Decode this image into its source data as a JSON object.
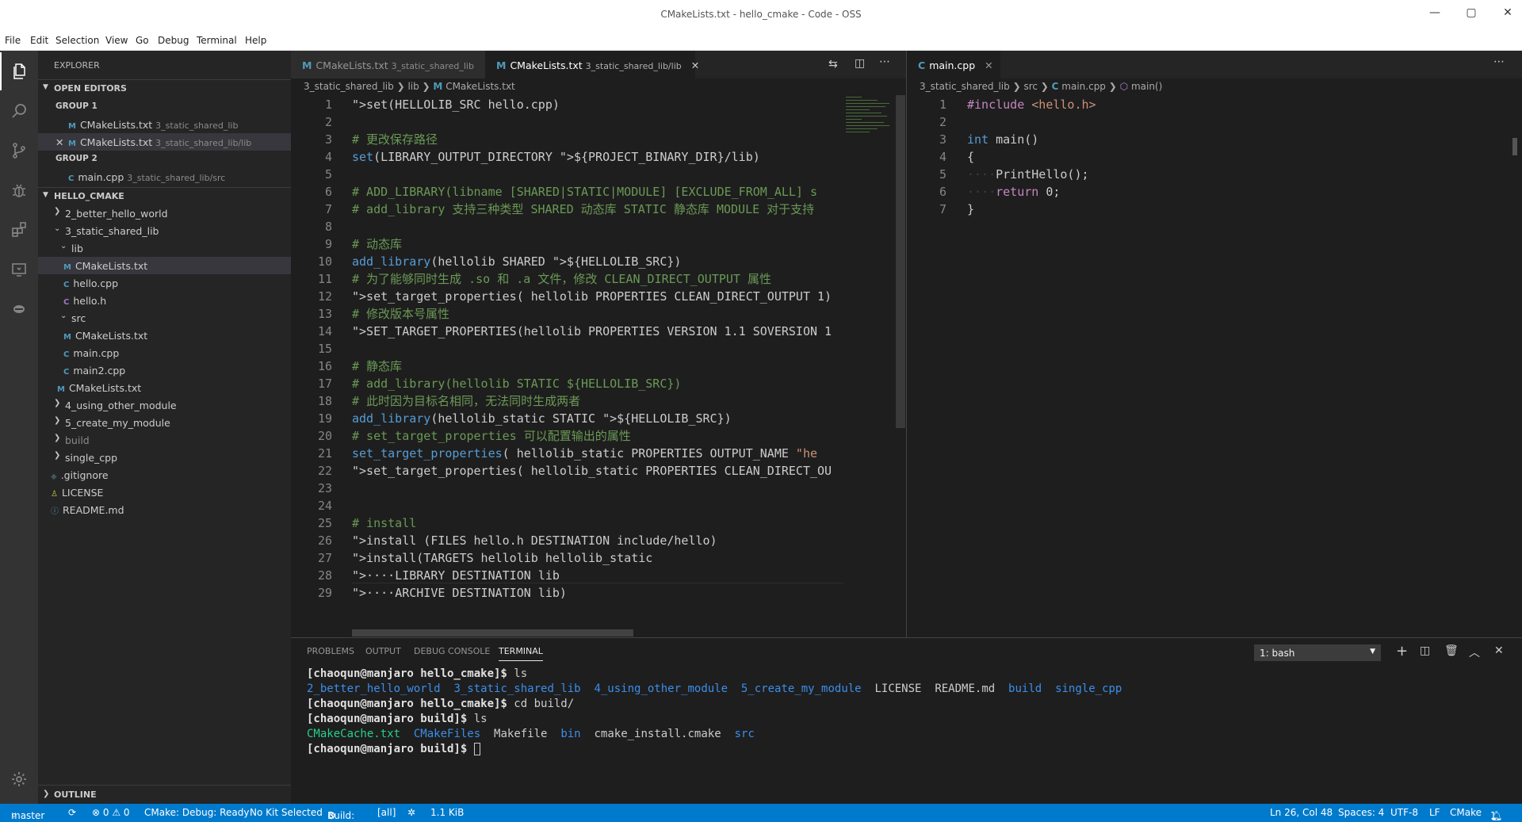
{
  "window": {
    "title": "CMakeLists.txt - hello_cmake - Code - OSS"
  },
  "menu": [
    "File",
    "Edit",
    "Selection",
    "View",
    "Go",
    "Debug",
    "Terminal",
    "Help"
  ],
  "sidebar": {
    "header": "EXPLORER",
    "open_editors_label": "OPEN EDITORS",
    "group1_label": "GROUP 1",
    "group2_label": "GROUP 2",
    "open_editors": [
      {
        "name": "CMakeLists.txt",
        "desc": "3_static_shared_lib"
      },
      {
        "name": "CMakeLists.txt",
        "desc": "3_static_shared_lib/lib"
      },
      {
        "name": "main.cpp",
        "desc": "3_static_shared_lib/src"
      }
    ],
    "project_label": "HELLO_CMAKE",
    "tree": [
      "2_better_hello_world",
      "3_static_shared_lib",
      "lib",
      "CMakeLists.txt",
      "hello.cpp",
      "hello.h",
      "src",
      "CMakeLists.txt",
      "main.cpp",
      "main2.cpp",
      "CMakeLists.txt",
      "4_using_other_module",
      "5_create_my_module",
      "build",
      "single_cpp",
      ".gitignore",
      "LICENSE",
      "README.md"
    ],
    "outline_label": "OUTLINE"
  },
  "editor1": {
    "tabs": [
      {
        "name": "CMakeLists.txt",
        "desc": "3_static_shared_lib"
      },
      {
        "name": "CMakeLists.txt",
        "desc": "3_static_shared_lib/lib"
      }
    ],
    "breadcrumb": [
      "3_static_shared_lib",
      "lib",
      "CMakeLists.txt"
    ],
    "lines": [
      "set(HELLOLIB_SRC hello.cpp)",
      "",
      "# 更改保存路径",
      "set(LIBRARY_OUTPUT_DIRECTORY ${PROJECT_BINARY_DIR}/lib)",
      "",
      "# ADD_LIBRARY(libname [SHARED|STATIC|MODULE] [EXCLUDE_FROM_ALL] s",
      "# add_library 支持三种类型 SHARED 动态库 STATIC 静态库 MODULE 对于支持",
      "",
      "# 动态库",
      "add_library(hellolib SHARED ${HELLOLIB_SRC})",
      "# 为了能够同时生成 .so 和 .a 文件，修改 CLEAN_DIRECT_OUTPUT 属性",
      "set_target_properties( hellolib PROPERTIES CLEAN_DIRECT_OUTPUT 1)",
      "# 修改版本号属性",
      "SET_TARGET_PROPERTIES(hellolib PROPERTIES VERSION 1.1 SOVERSION 1",
      "",
      "# 静态库",
      "# add_library(hellolib STATIC ${HELLOLIB_SRC})",
      "# 此时因为目标名相同，无法同时生成两者",
      "add_library(hellolib_static STATIC ${HELLOLIB_SRC})",
      "# set_target_properties 可以配置输出的属性",
      "set_target_properties( hellolib_static PROPERTIES OUTPUT_NAME \"he",
      "set_target_properties( hellolib_static PROPERTIES CLEAN_DIRECT_OU",
      "",
      "",
      "# install",
      "install (FILES hello.h DESTINATION include/hello)",
      "install(TARGETS hellolib hellolib_static",
      "····LIBRARY DESTINATION lib",
      "····ARCHIVE DESTINATION lib)"
    ]
  },
  "editor2": {
    "tab": "main.cpp",
    "breadcrumb": [
      "3_static_shared_lib",
      "src",
      "main.cpp",
      "main()"
    ],
    "lines": [
      "#include <hello.h>",
      "",
      "int main()",
      "{",
      "····PrintHello();",
      "····return 0;",
      "}"
    ]
  },
  "panel": {
    "tabs": [
      "PROBLEMS",
      "OUTPUT",
      "DEBUG CONSOLE",
      "TERMINAL"
    ],
    "terminal_select": "1: bash",
    "terminal": {
      "prompt1": "[chaoqun@manjaro hello_cmake]$ ls",
      "ls1": [
        "2_better_hello_world",
        "3_static_shared_lib",
        "4_using_other_module",
        "5_create_my_module",
        "LICENSE",
        "README.md",
        "build",
        "single_cpp"
      ],
      "prompt2": "[chaoqun@manjaro hello_cmake]$ cd build/",
      "prompt3": "[chaoqun@manjaro build]$ ls",
      "ls2": [
        "CMakeCache.txt",
        "CMakeFiles",
        "Makefile",
        "bin",
        "cmake_install.cmake",
        "src"
      ],
      "prompt4": "[chaoqun@manjaro build]$ "
    }
  },
  "status": {
    "branch": "master",
    "problems": "⊗ 0 ⚠ 0",
    "cmake": "CMake: Debug: Ready",
    "kit": "No Kit Selected",
    "build": "Build:",
    "target": "[all]",
    "size": "1.1 KiB",
    "position": "Ln 26, Col 48",
    "spaces": "Spaces: 4",
    "encoding": "UTF-8",
    "eol": "LF",
    "language": "CMake",
    "notif": "1"
  },
  "colors": {
    "accent": "#007acc",
    "activity": "#333333",
    "sidebar": "#252526",
    "editor": "#1e1e1e"
  }
}
